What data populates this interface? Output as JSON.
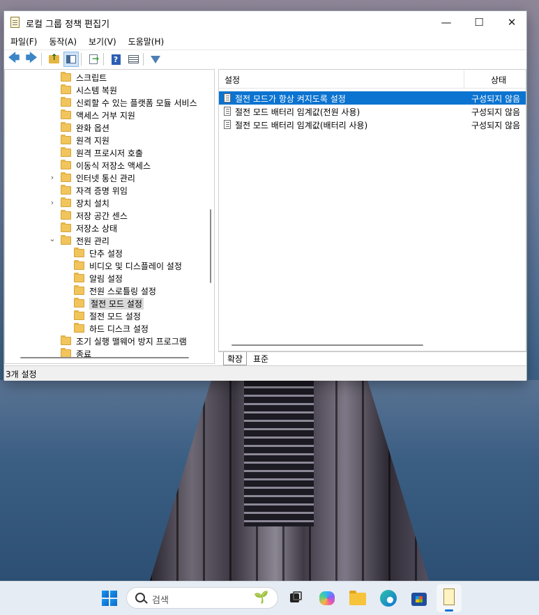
{
  "window": {
    "title": "로컬 그룹 정책 편집기",
    "controls": {
      "minimize": "—",
      "maximize": "☐",
      "close": "✕"
    }
  },
  "menu": [
    "파일(F)",
    "동작(A)",
    "보기(V)",
    "도움말(H)"
  ],
  "toolbar": {
    "buttons": [
      "back-arrow-icon",
      "forward-arrow-icon",
      "folder-up-icon",
      "show-hide-tree-icon",
      "export-list-icon",
      "help-icon",
      "view-icon",
      "filter-icon"
    ],
    "back": "🡄",
    "forward": "🡆",
    "help": "?"
  },
  "tree": {
    "items": [
      {
        "label": "스크립트",
        "expander": ""
      },
      {
        "label": "시스템 복원",
        "expander": ""
      },
      {
        "label": "신뢰할 수 있는 플랫폼 모듈 서비스",
        "expander": ""
      },
      {
        "label": "액세스 거부 지원",
        "expander": ""
      },
      {
        "label": "완화 옵션",
        "expander": ""
      },
      {
        "label": "원격 지원",
        "expander": ""
      },
      {
        "label": "원격 프로시저 호출",
        "expander": ""
      },
      {
        "label": "이동식 저장소 액세스",
        "expander": ""
      },
      {
        "label": "인터넷 통신 관리",
        "expander": "›"
      },
      {
        "label": "자격 증명 위임",
        "expander": ""
      },
      {
        "label": "장치 설치",
        "expander": "›"
      },
      {
        "label": "저장 공간 센스",
        "expander": ""
      },
      {
        "label": "저장소 상태",
        "expander": ""
      },
      {
        "label": "전원 관리",
        "expander": "⌄"
      },
      {
        "label": "단추 설정",
        "expander": ""
      },
      {
        "label": "비디오 및 디스플레이 설정",
        "expander": ""
      },
      {
        "label": "알림 설정",
        "expander": ""
      },
      {
        "label": "전원 스로틀링 설정",
        "expander": ""
      },
      {
        "label": "절전 모드 설정",
        "expander": ""
      },
      {
        "label": "절전 모드 설정",
        "expander": ""
      },
      {
        "label": "하드 디스크 설정",
        "expander": ""
      },
      {
        "label": "조기 실행 맬웨어 방지 프로그램",
        "expander": ""
      },
      {
        "label": "종료",
        "expander": ""
      }
    ],
    "selected_index": 18
  },
  "list": {
    "columns": {
      "setting": "설정",
      "state": "상태"
    },
    "rows": [
      {
        "name": "절전 모드가 항상 켜지도록 설정",
        "state": "구성되지 않음",
        "selected": true
      },
      {
        "name": "절전 모드 배터리 임계값(전원 사용)",
        "state": "구성되지 않음",
        "selected": false
      },
      {
        "name": "절전 모드 배터리 임계값(배터리 사용)",
        "state": "구성되지 않음",
        "selected": false
      }
    ]
  },
  "tabs": [
    "확장",
    "표준"
  ],
  "status": "3개 설정",
  "taskbar": {
    "search_placeholder": "검색",
    "apps": [
      "start-icon",
      "task-view-icon",
      "copilot-icon",
      "file-explorer-icon",
      "edge-icon",
      "store-icon",
      "group-policy-editor-icon"
    ],
    "plant": "🌱"
  }
}
